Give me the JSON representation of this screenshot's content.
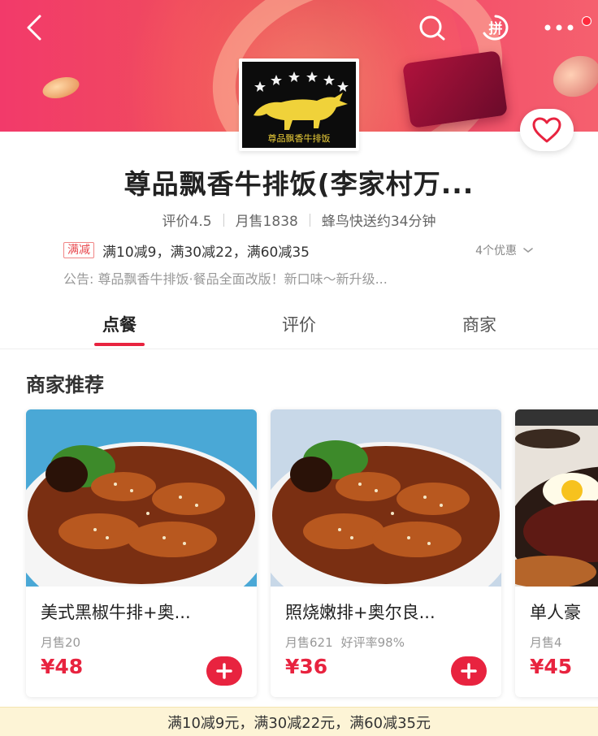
{
  "header": {
    "back_icon": "back-arrow-icon",
    "search_icon": "search-icon",
    "pin_icon": "pin-group-icon",
    "pin_text": "拼",
    "more_icon": "more-dots-icon",
    "favorite_icon": "heart-icon"
  },
  "logo": {
    "text": "尊品飘香牛排饭"
  },
  "shop": {
    "name": "尊品飘香牛排饭(李家村万...",
    "rating": "评价4.5",
    "monthly_sales": "月售1838",
    "delivery": "蜂鸟快送约34分钟",
    "promo_tag": "满减",
    "promo_text": "满10减9，满30减22，满60减35",
    "promo_more": "4个优惠",
    "notice": "公告: 尊品飘香牛排饭·餐品全面改版！新口味～新升级..."
  },
  "tabs": [
    {
      "label": "点餐",
      "active": true
    },
    {
      "label": "评价",
      "active": false
    },
    {
      "label": "商家",
      "active": false
    }
  ],
  "recommend": {
    "title": "商家推荐",
    "items": [
      {
        "name": "美式黑椒牛排+奥...",
        "sales": "月售20",
        "rating": "",
        "price": "¥48"
      },
      {
        "name": "照烧嫩排+奥尔良...",
        "sales": "月售621",
        "rating": "好评率98%",
        "price": "¥36"
      },
      {
        "name": "单人豪",
        "sales": "月售4",
        "rating": "",
        "price": "¥45"
      }
    ]
  },
  "discount_bar": {
    "text": "满10减9元，满30减22元，满60减35元"
  },
  "colors": {
    "accent": "#e8233f",
    "banner": "#f0485e",
    "discount_bg": "#fdf4d6"
  }
}
